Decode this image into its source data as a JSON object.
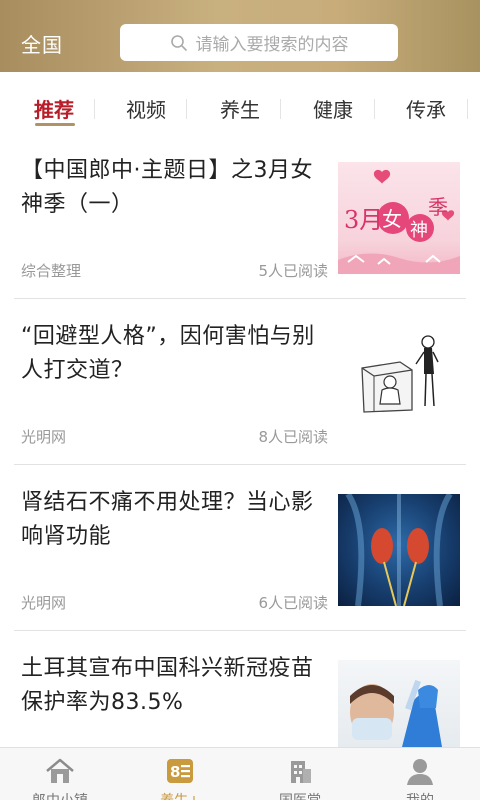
{
  "header": {
    "region": "全国",
    "search_placeholder": "请输入要搜索的内容"
  },
  "tabs": [
    {
      "label": "推荐",
      "active": true
    },
    {
      "label": "视频",
      "active": false
    },
    {
      "label": "养生",
      "active": false
    },
    {
      "label": "健康",
      "active": false
    },
    {
      "label": "传承",
      "active": false
    }
  ],
  "articles": [
    {
      "title": "【中国郎中·主题日】之3月女神季（一）",
      "source": "综合整理",
      "reads": "5人已阅读",
      "thumb_text": [
        "3月",
        "女",
        "神",
        "季"
      ]
    },
    {
      "title": "“回避型人格”，因何害怕与别人打交道？",
      "source": "光明网",
      "reads": "8人已阅读"
    },
    {
      "title": "肾结石不痛不用处理？当心影响肾功能",
      "source": "光明网",
      "reads": "6人已阅读"
    },
    {
      "title": "土耳其宣布中国科兴新冠疫苗保护率为83.5%",
      "source": "",
      "reads": ""
    }
  ],
  "bottom_nav": [
    {
      "label": "郎中小镇",
      "icon": "house-icon",
      "active": false
    },
    {
      "label": "养生+",
      "icon": "wellness-icon",
      "active": true
    },
    {
      "label": "国医堂",
      "icon": "clinic-icon",
      "active": false
    },
    {
      "label": "我的",
      "icon": "user-icon",
      "active": false
    }
  ],
  "colors": {
    "header_gold": "#c3a878",
    "active_tab": "#b81e2a",
    "nav_active": "#c99a3e"
  }
}
